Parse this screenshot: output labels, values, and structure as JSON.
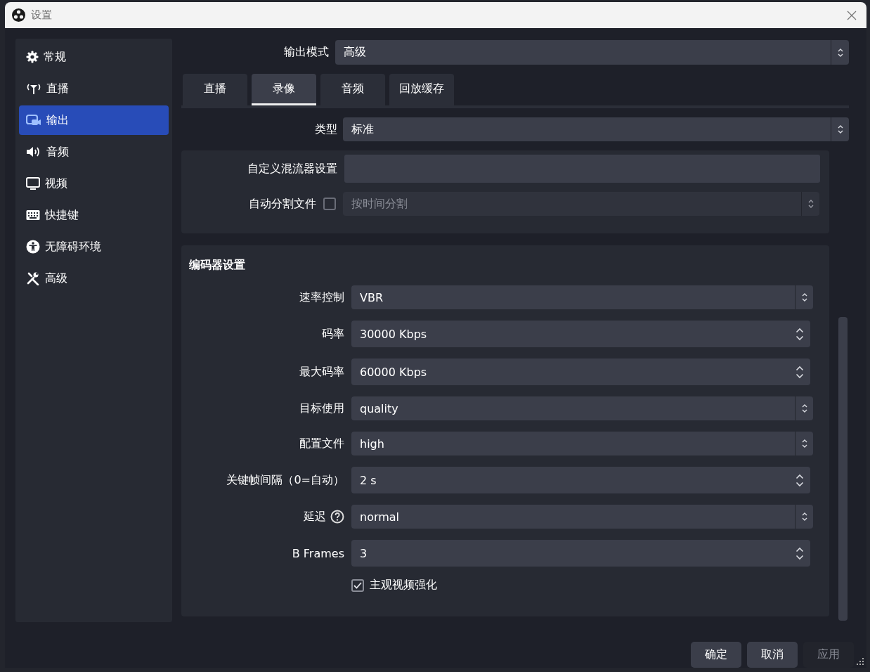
{
  "window": {
    "title": "设置"
  },
  "sidebar": {
    "items": [
      {
        "label": "常规",
        "kind": "gear",
        "selected": false
      },
      {
        "label": "直播",
        "kind": "antenna",
        "selected": false
      },
      {
        "label": "输出",
        "kind": "output",
        "selected": true
      },
      {
        "label": "音频",
        "kind": "speaker",
        "selected": false
      },
      {
        "label": "视频",
        "kind": "monitor",
        "selected": false
      },
      {
        "label": "快捷键",
        "kind": "keyboard",
        "selected": false
      },
      {
        "label": "无障碍环境",
        "kind": "accessibility",
        "selected": false
      },
      {
        "label": "高级",
        "kind": "tools",
        "selected": false
      }
    ]
  },
  "output_mode": {
    "label": "输出模式",
    "value": "高级"
  },
  "tabs": [
    {
      "label": "直播",
      "selected": false
    },
    {
      "label": "录像",
      "selected": true
    },
    {
      "label": "音频",
      "selected": false
    },
    {
      "label": "回放缓存",
      "selected": false
    }
  ],
  "type": {
    "label": "类型",
    "value": "标准"
  },
  "recording_settings": {
    "rows": [
      {
        "kind": "text",
        "label": "自定义混流器设置"
      },
      {
        "kind": "check_combo",
        "label": "自动分割文件",
        "checked": false,
        "value": "按时间分割",
        "disabled": true
      }
    ]
  },
  "encoder_settings": {
    "title": "编码器设置",
    "rows": [
      {
        "kind": "combo",
        "label": "速率控制",
        "value": "VBR"
      },
      {
        "kind": "spin",
        "label": "码率",
        "value": "30000 Kbps"
      },
      {
        "kind": "spin",
        "label": "最大码率",
        "value": "60000 Kbps"
      },
      {
        "kind": "combo",
        "label": "目标使用",
        "value": "quality"
      },
      {
        "kind": "combo",
        "label": "配置文件",
        "value": "high"
      },
      {
        "kind": "spin",
        "label": "关键帧间隔（0=自动）",
        "value": "2 s"
      },
      {
        "kind": "combo",
        "label": "延迟",
        "value": "normal",
        "help": true
      },
      {
        "kind": "spin",
        "label": "B Frames",
        "value": "3"
      },
      {
        "kind": "checkbox",
        "label": "主观视频强化",
        "checked": true
      }
    ]
  },
  "buttons": [
    {
      "label": "确定",
      "disabled": false
    },
    {
      "label": "取消",
      "disabled": false
    },
    {
      "label": "应用",
      "disabled": true
    }
  ]
}
